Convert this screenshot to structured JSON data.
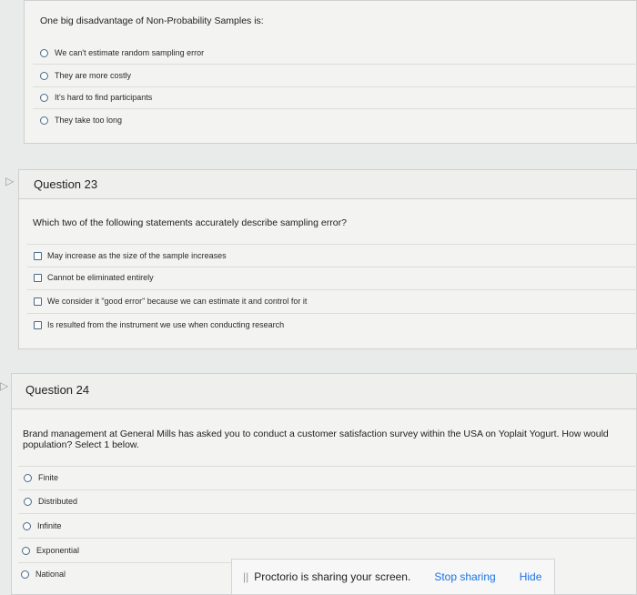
{
  "q22": {
    "prompt": "One big disadvantage of Non-Probability Samples is:",
    "options": [
      "We can't estimate random sampling error",
      "They are more costly",
      "It's hard to find participants",
      "They take too long"
    ]
  },
  "q23": {
    "title": "Question 23",
    "prompt": "Which two of the following statements accurately describe sampling error?",
    "options": [
      "May increase as the size of the sample increases",
      "Cannot be eliminated entirely",
      "We consider it \"good error\" because we can estimate it and control for it",
      "Is resulted from the instrument we use when conducting research"
    ]
  },
  "q24": {
    "title": "Question 24",
    "prompt_line1": "Brand management at General Mills has asked you to conduct a customer satisfaction survey within the USA on Yoplait Yogurt. How would",
    "prompt_line2": "population? Select 1 below.",
    "options": [
      "Finite",
      "Distributed",
      "Infinite",
      "Exponential",
      "National"
    ]
  },
  "proctorio": {
    "message": "Proctorio is sharing your screen.",
    "stop_label": "Stop sharing",
    "hide_label": "Hide",
    "accent": "#1a73e8"
  }
}
